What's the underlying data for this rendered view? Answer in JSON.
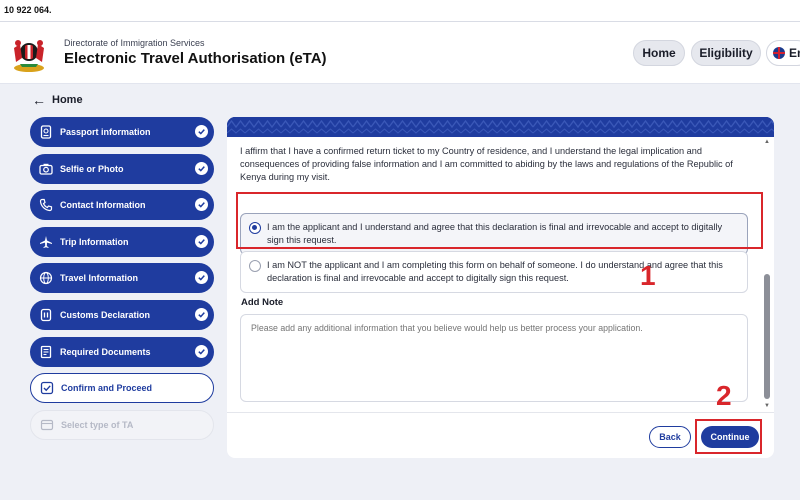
{
  "top_strip": {
    "text": "10 922 064."
  },
  "header": {
    "org": "Directorate of Immigration Services",
    "title": "Electronic Travel Authorisation (eTA)",
    "nav": {
      "home": "Home",
      "eligibility": "Eligibility",
      "language": "En"
    }
  },
  "back_link": {
    "label": "Home"
  },
  "sidebar": {
    "items": [
      {
        "label": "Passport information",
        "icon": "passport-icon",
        "state": "complete"
      },
      {
        "label": "Selfie or Photo",
        "icon": "camera-icon",
        "state": "complete"
      },
      {
        "label": "Contact Information",
        "icon": "phone-icon",
        "state": "complete"
      },
      {
        "label": "Trip Information",
        "icon": "plane-icon",
        "state": "complete"
      },
      {
        "label": "Travel Information",
        "icon": "globe-icon",
        "state": "complete"
      },
      {
        "label": "Customs Declaration",
        "icon": "customs-icon",
        "state": "complete"
      },
      {
        "label": "Required Documents",
        "icon": "document-icon",
        "state": "complete"
      },
      {
        "label": "Confirm and Proceed",
        "icon": "checkbox-icon",
        "state": "current"
      },
      {
        "label": "Select type of TA",
        "icon": "card-icon",
        "state": "disabled"
      }
    ]
  },
  "main": {
    "affirmation": "I affirm that I have a confirmed return ticket to my Country of residence, and I understand the legal implication and consequences of providing false information and I am committed to abiding by the laws and regulations of the Republic of Kenya during my visit.",
    "options": [
      {
        "text": "I am the applicant and I understand and agree that this declaration is final and irrevocable and accept to digitally sign this request.",
        "selected": true
      },
      {
        "text": "I am NOT the applicant and I am completing this form on behalf of someone. I do understand and agree that this declaration is final and irrevocable and accept to digitally sign this request.",
        "selected": false
      }
    ],
    "note_label": "Add Note",
    "note_placeholder": "Please add any additional information that you believe would help us better process your application.",
    "buttons": {
      "back": "Back",
      "continue": "Continue"
    }
  },
  "annotations": {
    "step1": "1",
    "step2": "2"
  },
  "colors": {
    "primary": "#1f3c9f",
    "highlight": "#d9262b"
  }
}
